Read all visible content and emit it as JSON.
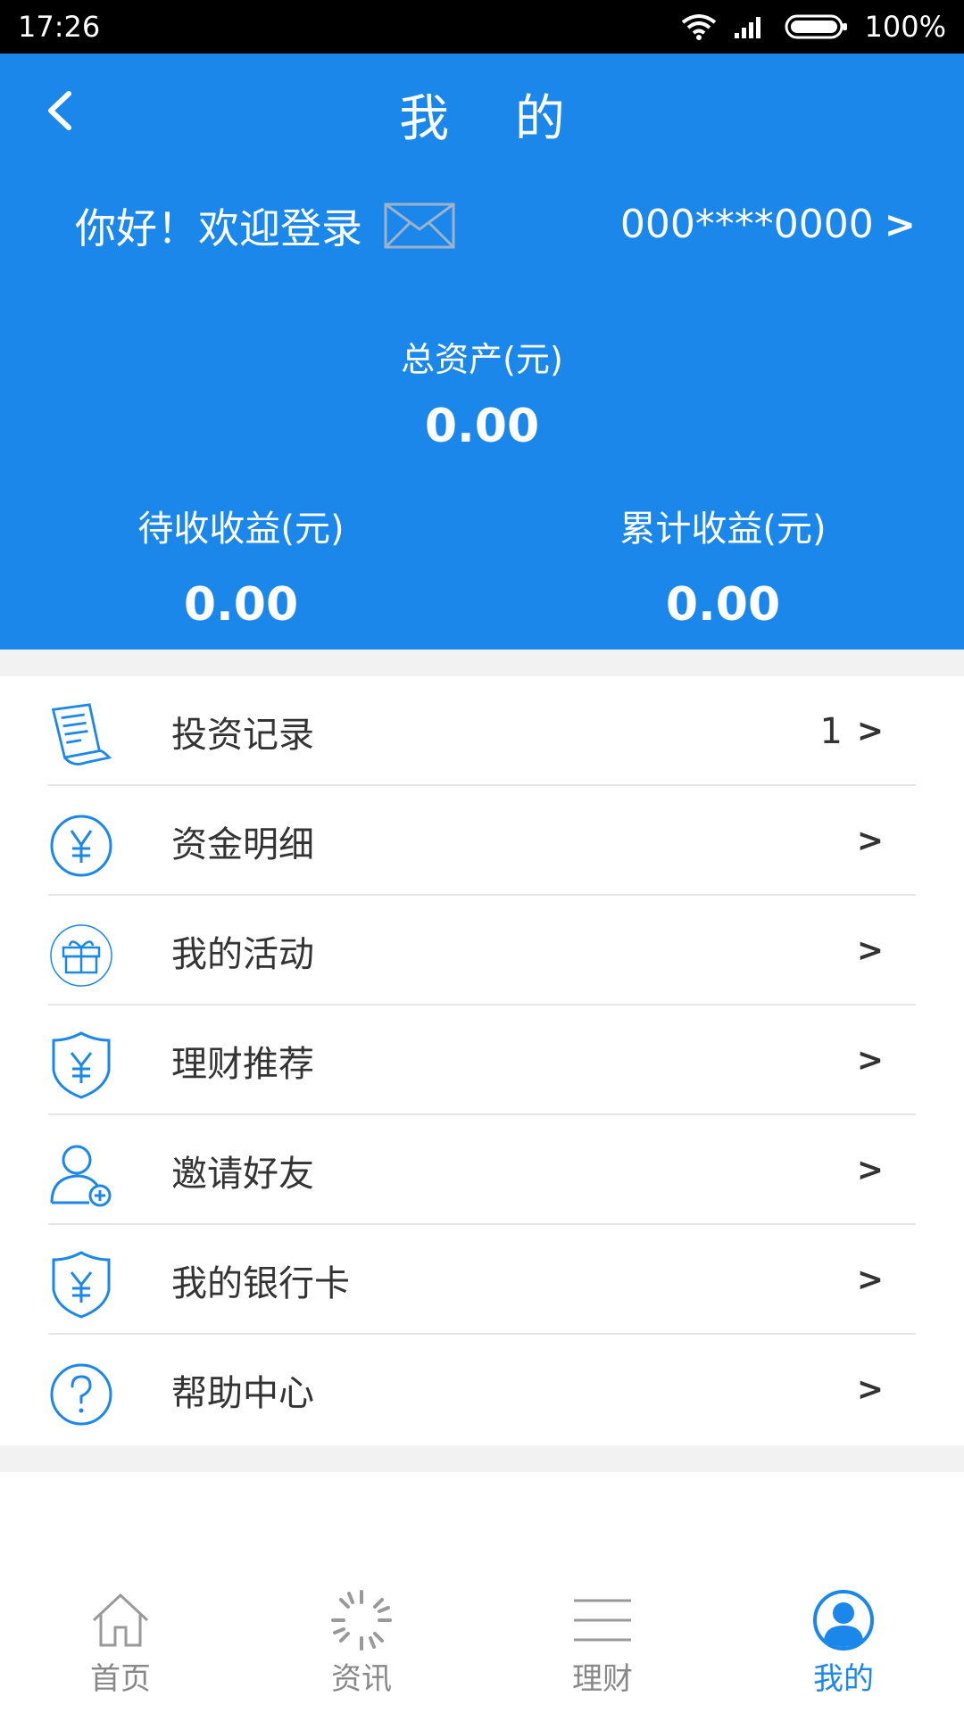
{
  "statusbar": {
    "time": "17:26",
    "battery": "100%"
  },
  "header": {
    "title": "我 的",
    "welcome": "你好！欢迎登录",
    "account": "000****0000",
    "account_chevron": ">",
    "total_label": "总资产(元)",
    "total_value": "0.00",
    "pending_label": "待收收益(元)",
    "pending_value": "0.00",
    "accumulated_label": "累计收益(元)",
    "accumulated_value": "0.00"
  },
  "menu": {
    "chevron": ">",
    "items": [
      {
        "label": "投资记录",
        "count": "1",
        "icon": "receipt-icon"
      },
      {
        "label": "资金明细",
        "count": "",
        "icon": "yen-circle-icon"
      },
      {
        "label": "我的活动",
        "count": "",
        "icon": "gift-icon"
      },
      {
        "label": "理财推荐",
        "count": "",
        "icon": "yen-shield-icon"
      },
      {
        "label": "邀请好友",
        "count": "",
        "icon": "add-user-icon"
      },
      {
        "label": "我的银行卡",
        "count": "",
        "icon": "yen-shield-icon"
      },
      {
        "label": "帮助中心",
        "count": "",
        "icon": "help-icon"
      }
    ]
  },
  "tabs": [
    {
      "label": "首页",
      "icon": "home-icon",
      "active": false
    },
    {
      "label": "资讯",
      "icon": "loading-icon",
      "active": false
    },
    {
      "label": "理财",
      "icon": "menu-lines-icon",
      "active": false
    },
    {
      "label": "我的",
      "icon": "user-icon",
      "active": true
    }
  ],
  "colors": {
    "brand": "#1b87ea",
    "band": "#f2f2f2",
    "text": "#333333",
    "tab_inactive": "#888888"
  }
}
